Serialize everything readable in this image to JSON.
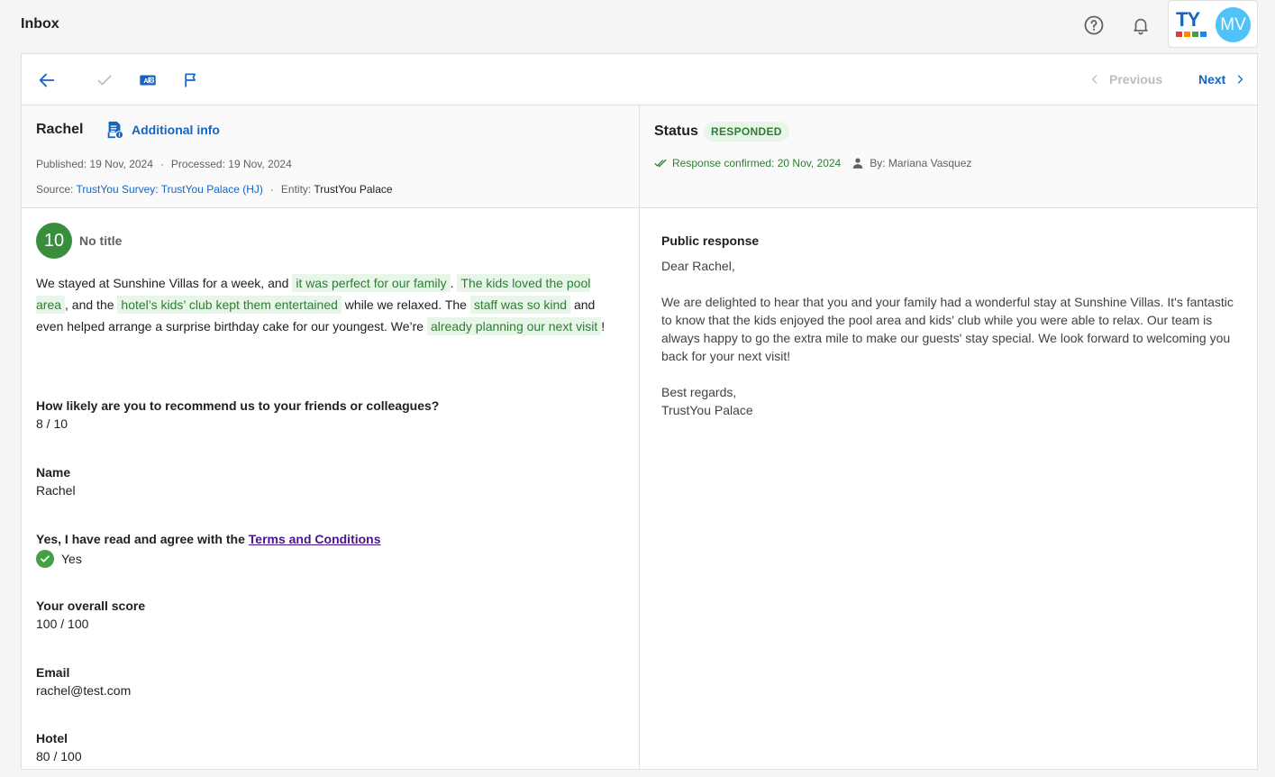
{
  "header": {
    "title": "Inbox",
    "brand_logo_text": "TY",
    "avatar_initials": "MV",
    "colors": {
      "brand": "#1565c0",
      "avatar": "#4fc3f7",
      "bar1": "#e53935",
      "bar2": "#fb8c00",
      "bar3": "#43a047"
    }
  },
  "toolbar": {
    "prev_label": "Previous",
    "next_label": "Next"
  },
  "review": {
    "reviewer_name": "Rachel",
    "additional_info_label": "Additional info",
    "published_label": "Published:",
    "published_date": "19 Nov, 2024",
    "processed_label": "Processed:",
    "processed_date": "19 Nov, 2024",
    "source_label": "Source:",
    "source_value": "TrustYou Survey: TrustYou Palace (HJ)",
    "entity_label": "Entity:",
    "entity_value": "TrustYou Palace",
    "score": "10",
    "title": "No title",
    "text": {
      "p1": "We stayed at Sunshine Villas for a week, and",
      "h1": "it was perfect for our family",
      "p2": ".",
      "h2": "The kids loved the pool area",
      "p3": ", and the",
      "h3": "hotel’s kids’ club kept them entertained",
      "p4": "while we relaxed. The",
      "h4": "staff was so kind",
      "p5": "and even helped arrange a surprise birthday cake for our youngest. We’re",
      "h5": "already planning our next visit",
      "p6": "!"
    },
    "questions": [
      {
        "q": "How likely are you to recommend us to your friends or colleagues?",
        "a": "8 / 10"
      },
      {
        "q": "Name",
        "a": "Rachel"
      },
      {
        "q_prefix": "Yes, I have read and agree with the",
        "q_link": "Terms and Conditions",
        "a": "Yes"
      },
      {
        "q": "Your overall score",
        "a": "100 / 100"
      },
      {
        "q": "Email",
        "a": "rachel@test.com"
      },
      {
        "q": "Hotel",
        "a": "80 / 100"
      }
    ]
  },
  "status": {
    "label": "Status",
    "badge": "RESPONDED",
    "confirmed_text": "Response confirmed: 20 Nov, 2024",
    "by_text": "By: Mariana Vasquez",
    "colors": {
      "badge_bg": "#e8f5e9",
      "badge_fg": "#2e7d32"
    }
  },
  "response": {
    "title": "Public response",
    "body": "Dear Rachel,\n\nWe are delighted to hear that you and your family had a wonderful stay at Sunshine Villas. It's fantastic to know that the kids enjoyed the pool area and kids' club while you were able to relax. Our team is always happy to go the extra mile to make our guests' stay special. We look forward to welcoming you back for your next visit!\n\nBest regards,\nTrustYou Palace"
  }
}
